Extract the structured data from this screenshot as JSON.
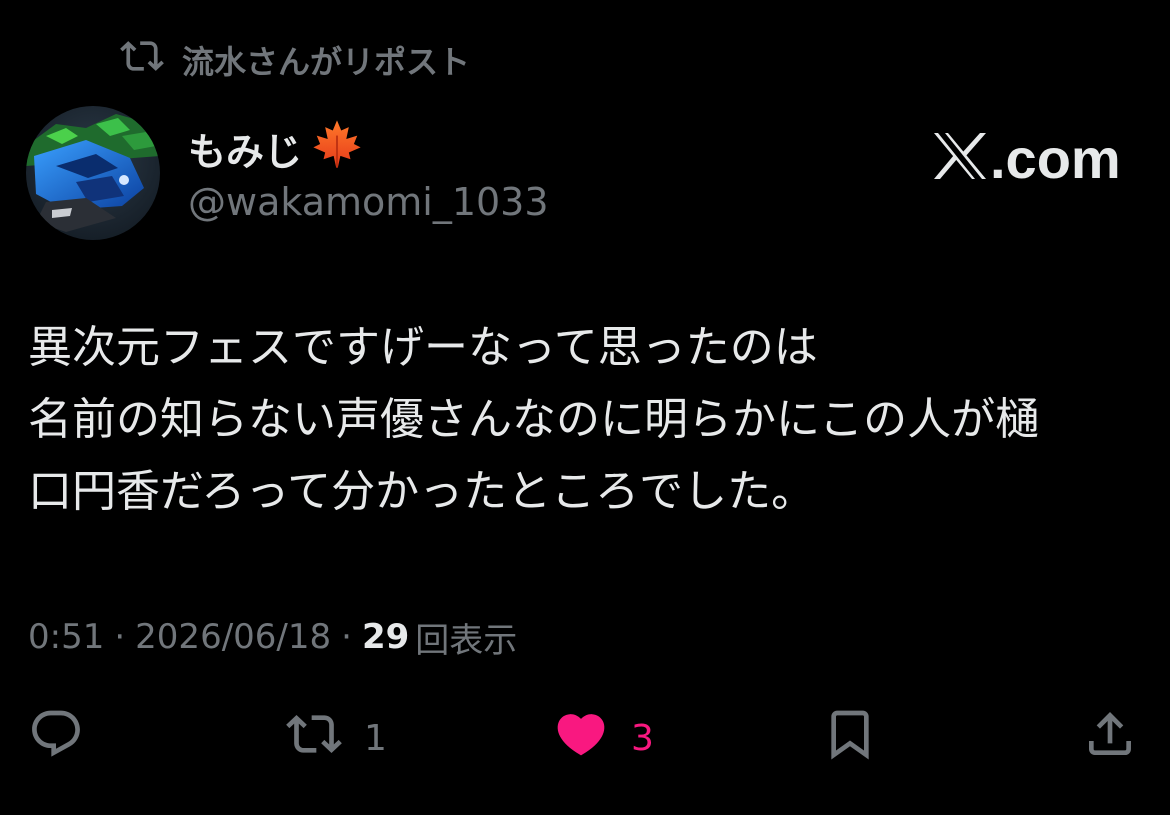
{
  "repost": {
    "icon": "repost-icon",
    "text": "流水さんがリポスト"
  },
  "author": {
    "avatar": "avatar",
    "name": "もみじ",
    "name_emoji": "maple-leaf-icon",
    "handle": "@wakamomi_1033"
  },
  "brand": {
    "icon": "x-logo-icon",
    "text": ".com"
  },
  "post": {
    "lines": [
      "異次元フェスですげーなって思ったのは",
      "名前の知らない声優さんなのに明らかにこの人が樋",
      "口円香だろって分かったところでした。"
    ]
  },
  "meta": {
    "time": "0:51",
    "separator": "·",
    "date": "2026/06/18",
    "views_count": "29",
    "views_label": "回表示"
  },
  "actions": {
    "reply": {
      "icon": "reply-icon"
    },
    "retweet": {
      "icon": "retweet-icon",
      "count": "1"
    },
    "like": {
      "icon": "heart-icon",
      "count": "3",
      "color": "#f91880"
    },
    "bookmark": {
      "icon": "bookmark-icon"
    },
    "share": {
      "icon": "share-icon"
    }
  },
  "colors": {
    "background": "#000000",
    "primary_text": "#e7e9ea",
    "secondary_text": "#71767b",
    "like_active": "#f91880"
  }
}
